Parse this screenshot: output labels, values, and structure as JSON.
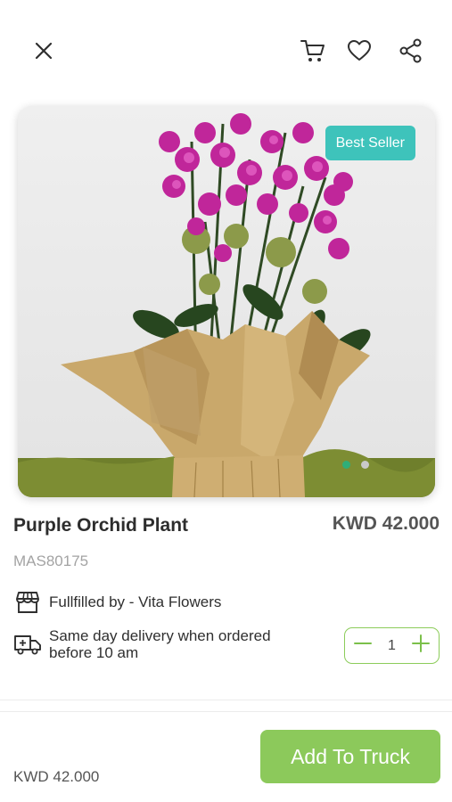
{
  "header": {
    "close_icon": "close-icon",
    "cart_icon": "cart-icon",
    "wishlist_icon": "heart-icon",
    "share_icon": "share-icon"
  },
  "product": {
    "badge": "Best Seller",
    "image_alt": "purple orchid in kraft paper wrap",
    "carousel": {
      "count": 2,
      "active_index": 0
    },
    "name": "Purple Orchid Plant",
    "price": "KWD 42.000",
    "sku": "MAS80175",
    "fulfilled_by": "Fullfilled by - Vita Flowers",
    "delivery_line1": "Same day delivery when ordered",
    "delivery_line2": "before 10 am",
    "quantity": "1"
  },
  "footer": {
    "total": "KWD 42.000",
    "cta_label": "Add To Truck"
  },
  "colors": {
    "accent_green": "#8cc95b",
    "badge_teal": "#3ec3bb",
    "dot_active": "#2fae78"
  }
}
